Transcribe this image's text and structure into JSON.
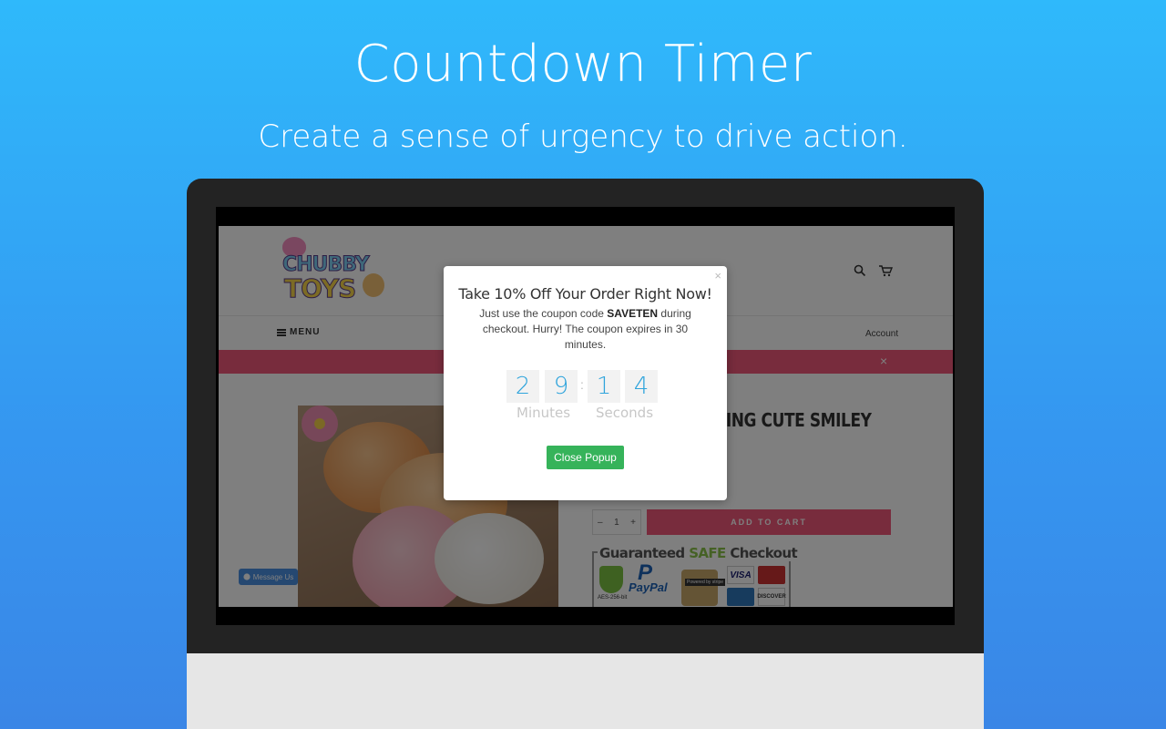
{
  "hero": {
    "title": "Countdown Timer",
    "subtitle": "Create a sense of urgency to drive action."
  },
  "store": {
    "logo_line1": "CHUBBY",
    "logo_line2": "TOYS",
    "menu_label": "MENU",
    "account_label": "Account",
    "promo_close": "×",
    "product_title": "SING CUTE SMILEY",
    "qty_minus": "–",
    "qty_value": "1",
    "qty_plus": "+",
    "add_to_cart": "ADD TO CART",
    "safe_checkout_prefix": "Guaranteed ",
    "safe_checkout_safe": "SAFE",
    "safe_checkout_suffix": " Checkout",
    "shield_text": "AES-256-bit",
    "paypal_text": "PayPal",
    "paypal_mark": "P",
    "stripe_text": "Powered by stripe",
    "visa_text": "VISA",
    "discover_text": "DISCOVER",
    "message_us": "Message Us"
  },
  "popup": {
    "close_symbol": "×",
    "title": "Take 10% Off Your Order Right Now!",
    "body_before": "Just use the coupon code ",
    "coupon_code": "SAVETEN",
    "body_after": " during checkout. Hurry! The coupon expires in 30 minutes.",
    "digits": [
      "2",
      "9",
      "1",
      "4"
    ],
    "separator": ":",
    "minutes_label": "Minutes",
    "seconds_label": "Seconds",
    "close_button": "Close Popup"
  },
  "colors": {
    "accent_pink": "#f0587a",
    "timer_digit": "#2fa4dc",
    "close_button": "#36b35a"
  }
}
